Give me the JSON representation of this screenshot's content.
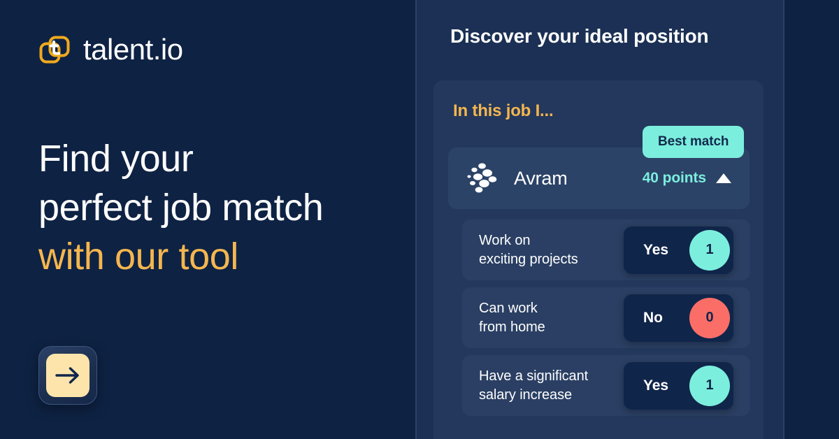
{
  "brand": {
    "logo_icon": "talent-io-squares-logo-icon",
    "name": "talent.io"
  },
  "hero": {
    "line1": "Find your",
    "line2": "perfect job match",
    "line3_accent": "with our tool",
    "cta_icon": "arrow-right-icon"
  },
  "panel": {
    "title": "Discover your ideal position",
    "card_title": "In this job I...",
    "badge": "Best match",
    "profile": {
      "avatar_icon": "dot-cluster-avatar-icon",
      "name": "Avram",
      "points": "40 points",
      "caret_icon": "caret-up-icon"
    },
    "questions": [
      {
        "line1": "Work on",
        "line2": "exciting projects",
        "answer": "Yes",
        "score": "1",
        "tone": "yes"
      },
      {
        "line1": "Can work",
        "line2": "from home",
        "answer": "No",
        "score": "0",
        "tone": "no"
      },
      {
        "line1": "Have a significant",
        "line2": "salary increase",
        "answer": "Yes",
        "score": "1",
        "tone": "yes"
      }
    ]
  },
  "colors": {
    "background": "#0e2243",
    "panel": "#1b3054",
    "card": "#23385c",
    "row": "#2a3f63",
    "accent_gold": "#f5b64f",
    "accent_mint": "#7ceedd",
    "accent_coral": "#fb6e68",
    "cta_cream": "#fde4ab",
    "text_white": "#ffffff"
  }
}
